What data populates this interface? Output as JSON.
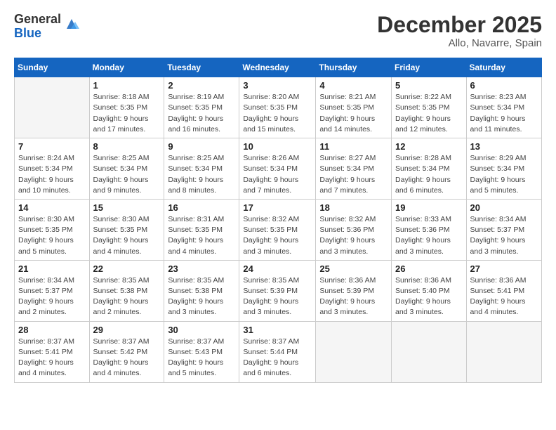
{
  "logo": {
    "general": "General",
    "blue": "Blue"
  },
  "title": "December 2025",
  "location": "Allo, Navarre, Spain",
  "weekdays": [
    "Sunday",
    "Monday",
    "Tuesday",
    "Wednesday",
    "Thursday",
    "Friday",
    "Saturday"
  ],
  "weeks": [
    [
      {
        "day": "",
        "info": ""
      },
      {
        "day": "1",
        "info": "Sunrise: 8:18 AM\nSunset: 5:35 PM\nDaylight: 9 hours\nand 17 minutes."
      },
      {
        "day": "2",
        "info": "Sunrise: 8:19 AM\nSunset: 5:35 PM\nDaylight: 9 hours\nand 16 minutes."
      },
      {
        "day": "3",
        "info": "Sunrise: 8:20 AM\nSunset: 5:35 PM\nDaylight: 9 hours\nand 15 minutes."
      },
      {
        "day": "4",
        "info": "Sunrise: 8:21 AM\nSunset: 5:35 PM\nDaylight: 9 hours\nand 14 minutes."
      },
      {
        "day": "5",
        "info": "Sunrise: 8:22 AM\nSunset: 5:35 PM\nDaylight: 9 hours\nand 12 minutes."
      },
      {
        "day": "6",
        "info": "Sunrise: 8:23 AM\nSunset: 5:34 PM\nDaylight: 9 hours\nand 11 minutes."
      }
    ],
    [
      {
        "day": "7",
        "info": "Sunrise: 8:24 AM\nSunset: 5:34 PM\nDaylight: 9 hours\nand 10 minutes."
      },
      {
        "day": "8",
        "info": "Sunrise: 8:25 AM\nSunset: 5:34 PM\nDaylight: 9 hours\nand 9 minutes."
      },
      {
        "day": "9",
        "info": "Sunrise: 8:25 AM\nSunset: 5:34 PM\nDaylight: 9 hours\nand 8 minutes."
      },
      {
        "day": "10",
        "info": "Sunrise: 8:26 AM\nSunset: 5:34 PM\nDaylight: 9 hours\nand 7 minutes."
      },
      {
        "day": "11",
        "info": "Sunrise: 8:27 AM\nSunset: 5:34 PM\nDaylight: 9 hours\nand 7 minutes."
      },
      {
        "day": "12",
        "info": "Sunrise: 8:28 AM\nSunset: 5:34 PM\nDaylight: 9 hours\nand 6 minutes."
      },
      {
        "day": "13",
        "info": "Sunrise: 8:29 AM\nSunset: 5:34 PM\nDaylight: 9 hours\nand 5 minutes."
      }
    ],
    [
      {
        "day": "14",
        "info": "Sunrise: 8:30 AM\nSunset: 5:35 PM\nDaylight: 9 hours\nand 5 minutes."
      },
      {
        "day": "15",
        "info": "Sunrise: 8:30 AM\nSunset: 5:35 PM\nDaylight: 9 hours\nand 4 minutes."
      },
      {
        "day": "16",
        "info": "Sunrise: 8:31 AM\nSunset: 5:35 PM\nDaylight: 9 hours\nand 4 minutes."
      },
      {
        "day": "17",
        "info": "Sunrise: 8:32 AM\nSunset: 5:35 PM\nDaylight: 9 hours\nand 3 minutes."
      },
      {
        "day": "18",
        "info": "Sunrise: 8:32 AM\nSunset: 5:36 PM\nDaylight: 9 hours\nand 3 minutes."
      },
      {
        "day": "19",
        "info": "Sunrise: 8:33 AM\nSunset: 5:36 PM\nDaylight: 9 hours\nand 3 minutes."
      },
      {
        "day": "20",
        "info": "Sunrise: 8:34 AM\nSunset: 5:37 PM\nDaylight: 9 hours\nand 3 minutes."
      }
    ],
    [
      {
        "day": "21",
        "info": "Sunrise: 8:34 AM\nSunset: 5:37 PM\nDaylight: 9 hours\nand 2 minutes."
      },
      {
        "day": "22",
        "info": "Sunrise: 8:35 AM\nSunset: 5:38 PM\nDaylight: 9 hours\nand 2 minutes."
      },
      {
        "day": "23",
        "info": "Sunrise: 8:35 AM\nSunset: 5:38 PM\nDaylight: 9 hours\nand 3 minutes."
      },
      {
        "day": "24",
        "info": "Sunrise: 8:35 AM\nSunset: 5:39 PM\nDaylight: 9 hours\nand 3 minutes."
      },
      {
        "day": "25",
        "info": "Sunrise: 8:36 AM\nSunset: 5:39 PM\nDaylight: 9 hours\nand 3 minutes."
      },
      {
        "day": "26",
        "info": "Sunrise: 8:36 AM\nSunset: 5:40 PM\nDaylight: 9 hours\nand 3 minutes."
      },
      {
        "day": "27",
        "info": "Sunrise: 8:36 AM\nSunset: 5:41 PM\nDaylight: 9 hours\nand 4 minutes."
      }
    ],
    [
      {
        "day": "28",
        "info": "Sunrise: 8:37 AM\nSunset: 5:41 PM\nDaylight: 9 hours\nand 4 minutes."
      },
      {
        "day": "29",
        "info": "Sunrise: 8:37 AM\nSunset: 5:42 PM\nDaylight: 9 hours\nand 4 minutes."
      },
      {
        "day": "30",
        "info": "Sunrise: 8:37 AM\nSunset: 5:43 PM\nDaylight: 9 hours\nand 5 minutes."
      },
      {
        "day": "31",
        "info": "Sunrise: 8:37 AM\nSunset: 5:44 PM\nDaylight: 9 hours\nand 6 minutes."
      },
      {
        "day": "",
        "info": ""
      },
      {
        "day": "",
        "info": ""
      },
      {
        "day": "",
        "info": ""
      }
    ]
  ]
}
